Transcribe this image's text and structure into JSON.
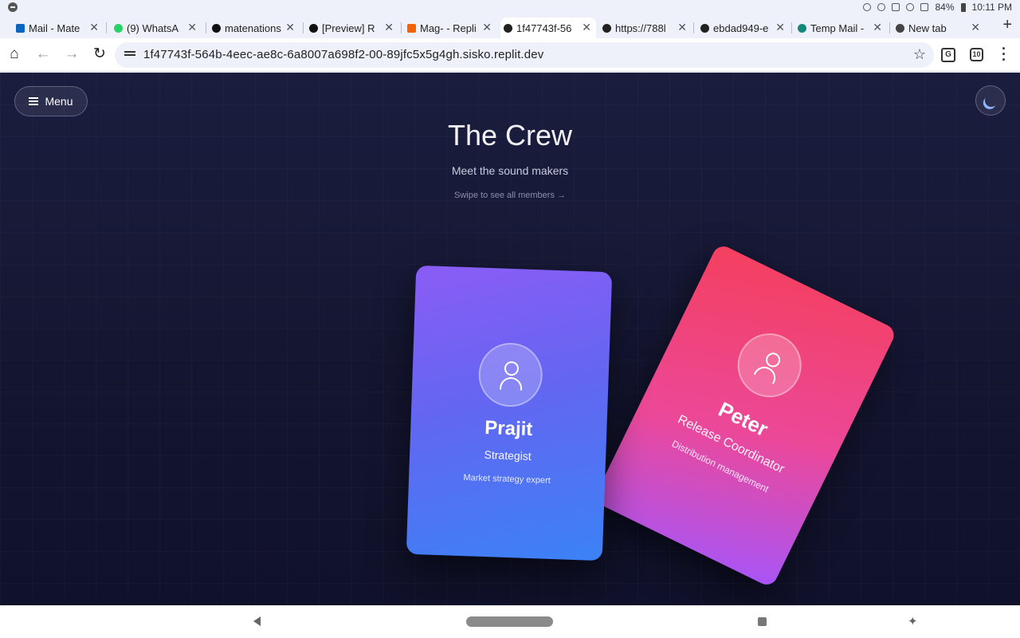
{
  "status_bar": {
    "battery": "84%",
    "time": "10:11 PM"
  },
  "tabs": [
    {
      "label": "Mail - Mate",
      "favicon_color": "#0a64c2"
    },
    {
      "label": "(9) WhatsA",
      "favicon_color": "#25d366"
    },
    {
      "label": "matenations",
      "favicon_color": "#111111"
    },
    {
      "label": "[Preview] R",
      "favicon_color": "#111111"
    },
    {
      "label": "Mag- - Repli",
      "favicon_color": "#f26207"
    },
    {
      "label": "1f47743f-56",
      "favicon_color": "#222222",
      "active": true
    },
    {
      "label": "https://788l",
      "favicon_color": "#222222"
    },
    {
      "label": "ebdad949-e",
      "favicon_color": "#222222"
    },
    {
      "label": "Temp Mail -",
      "favicon_color": "#12897c"
    },
    {
      "label": "New tab",
      "favicon_color": "#444444"
    }
  ],
  "address_bar": {
    "url": "1f47743f-564b-4eec-ae8c-6a8007a698f2-00-89jfc5x5g4gh.sisko.replit.dev",
    "tab_count": "10"
  },
  "page": {
    "menu_label": "Menu",
    "title": "The Crew",
    "subtitle": "Meet the sound makers",
    "hint": "Swipe to see all members →",
    "members": [
      {
        "name": "Prajit",
        "role": "Strategist",
        "description": "Market strategy expert",
        "gradient": [
          "#8b5cf6",
          "#3b82f6"
        ]
      },
      {
        "name": "Peter",
        "role": "Release Coordinator",
        "description": "Distribution management",
        "gradient": [
          "#f43f5e",
          "#a855f7"
        ]
      }
    ]
  }
}
